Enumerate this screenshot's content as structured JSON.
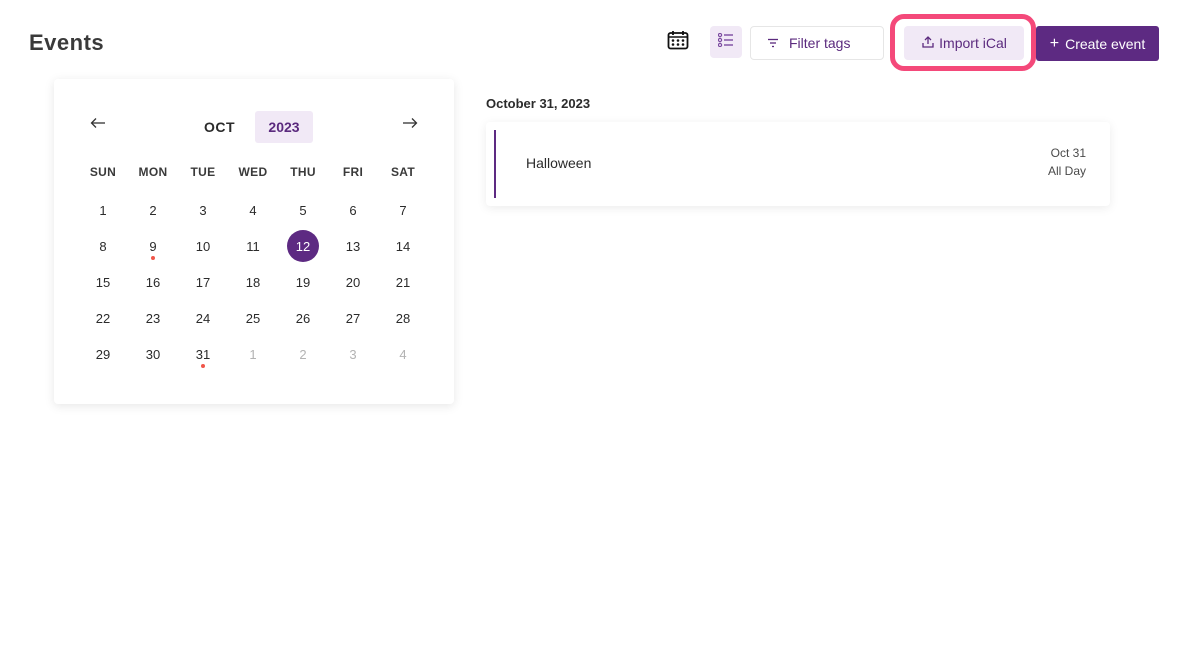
{
  "page": {
    "title": "Events"
  },
  "toolbar": {
    "calendar_view_icon": "calendar-grid-icon",
    "list_view_icon": "list-icon",
    "filter_label": "Filter tags",
    "filter_icon": "filter-icon",
    "import_label": "Import iCal",
    "import_icon": "upload-icon",
    "create_label": "Create event",
    "create_prefix": "+"
  },
  "calendar": {
    "month": "OCT",
    "year": "2023",
    "prev_icon": "arrow-left-icon",
    "next_icon": "arrow-right-icon",
    "weekdays": [
      "SUN",
      "MON",
      "TUE",
      "WED",
      "THU",
      "FRI",
      "SAT"
    ],
    "days": [
      {
        "d": "1"
      },
      {
        "d": "2"
      },
      {
        "d": "3"
      },
      {
        "d": "4"
      },
      {
        "d": "5"
      },
      {
        "d": "6"
      },
      {
        "d": "7"
      },
      {
        "d": "8"
      },
      {
        "d": "9",
        "event": true
      },
      {
        "d": "10"
      },
      {
        "d": "11"
      },
      {
        "d": "12",
        "selected": true
      },
      {
        "d": "13"
      },
      {
        "d": "14"
      },
      {
        "d": "15"
      },
      {
        "d": "16"
      },
      {
        "d": "17"
      },
      {
        "d": "18"
      },
      {
        "d": "19"
      },
      {
        "d": "20"
      },
      {
        "d": "21"
      },
      {
        "d": "22"
      },
      {
        "d": "23"
      },
      {
        "d": "24"
      },
      {
        "d": "25"
      },
      {
        "d": "26"
      },
      {
        "d": "27"
      },
      {
        "d": "28"
      },
      {
        "d": "29"
      },
      {
        "d": "30"
      },
      {
        "d": "31",
        "event": true
      },
      {
        "d": "1",
        "muted": true
      },
      {
        "d": "2",
        "muted": true
      },
      {
        "d": "3",
        "muted": true
      },
      {
        "d": "4",
        "muted": true
      }
    ]
  },
  "events": {
    "date_heading": "October 31, 2023",
    "items": [
      {
        "title": "Halloween",
        "date": "Oct 31",
        "time": "All Day"
      }
    ]
  },
  "colors": {
    "brand": "#5d2a82",
    "brand_light": "#f1e9f6",
    "highlight": "#f4497a",
    "event_dot": "#f0564a"
  }
}
